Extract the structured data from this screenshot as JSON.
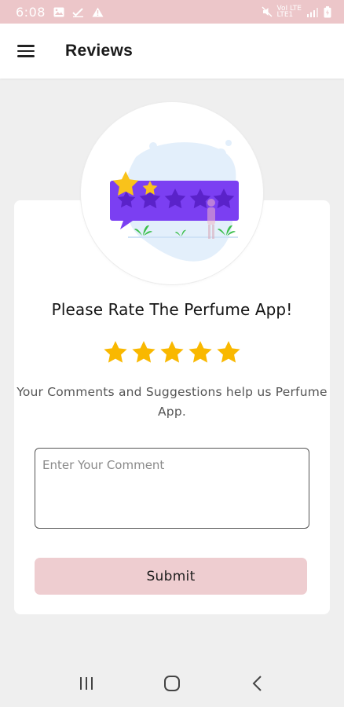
{
  "status_bar": {
    "time": "6:08",
    "network_label_top": "VoI LTE",
    "network_label_bottom": "LTE1",
    "icons": [
      "gallery-icon",
      "check-icon",
      "warning-icon",
      "mute-icon",
      "signal-icon",
      "battery-icon"
    ]
  },
  "app_bar": {
    "title": "Reviews",
    "menu_icon": "hamburger-menu-icon"
  },
  "review": {
    "heading": "Please Rate The Perfume App!",
    "rating_value": 5,
    "rating_max": 5,
    "star_color": "#f9b800",
    "subtitle": "Your Comments and Suggestions help us Perfume App.",
    "comment_placeholder": "Enter Your Comment",
    "comment_value": "",
    "submit_label": "Submit"
  },
  "colors": {
    "status_bar": "#ecc6c9",
    "accent_button": "#eecdd0",
    "illustration_purple": "#7b3ff2",
    "background": "#efefef"
  },
  "nav_bar": {
    "icons": [
      "recent-apps-icon",
      "home-icon",
      "back-icon"
    ]
  }
}
